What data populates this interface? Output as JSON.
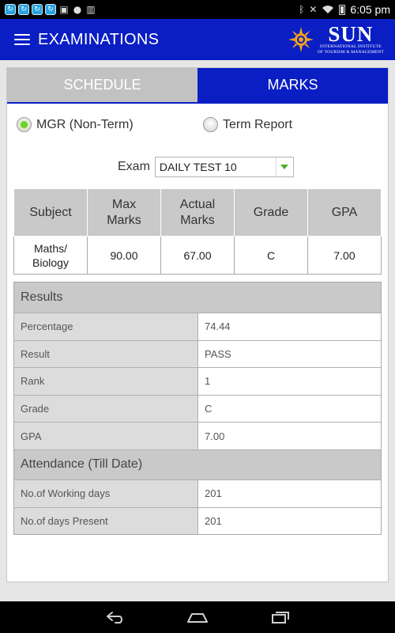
{
  "status_bar": {
    "time": "6:05 pm"
  },
  "app_bar": {
    "title": "EXAMINATIONS",
    "logo_name": "SUN",
    "logo_subtitle_1": "INTERNATIONAL INSTITUTE",
    "logo_subtitle_2": "OF TOURISM & MANAGEMENT"
  },
  "tabs": [
    {
      "label": "SCHEDULE",
      "active": false
    },
    {
      "label": "MARKS",
      "active": true
    }
  ],
  "report_type": {
    "options": [
      {
        "label": "MGR (Non-Term)",
        "selected": true
      },
      {
        "label": "Term Report",
        "selected": false
      }
    ]
  },
  "exam": {
    "label": "Exam",
    "selected": "DAILY TEST 10"
  },
  "marks_table": {
    "headers": [
      "Subject",
      "Max Marks",
      "Actual Marks",
      "Grade",
      "GPA"
    ],
    "rows": [
      [
        "Maths/ Biology",
        "90.00",
        "67.00",
        "C",
        "7.00"
      ]
    ]
  },
  "results": {
    "title": "Results",
    "rows": [
      {
        "label": "Percentage",
        "value": "74.44"
      },
      {
        "label": "Result",
        "value": "PASS"
      },
      {
        "label": "Rank",
        "value": "1"
      },
      {
        "label": "Grade",
        "value": "C"
      },
      {
        "label": "GPA",
        "value": "7.00"
      }
    ]
  },
  "attendance": {
    "title": "Attendance (Till Date)",
    "rows": [
      {
        "label": "No.of Working days",
        "value": "201"
      },
      {
        "label": "No.of days Present",
        "value": "201"
      }
    ]
  },
  "colors": {
    "brand_blue": "#0a1ec4",
    "tab_inactive": "#c2c2c2",
    "radio_selected": "#6fd12a",
    "header_gray": "#c9c9c9"
  },
  "icons": [
    "menu-icon",
    "sun-logo-icon",
    "back-icon",
    "home-icon",
    "recents-icon",
    "wifi-icon",
    "battery-icon",
    "bluetooth-icon",
    "dropdown-arrow-icon"
  ]
}
